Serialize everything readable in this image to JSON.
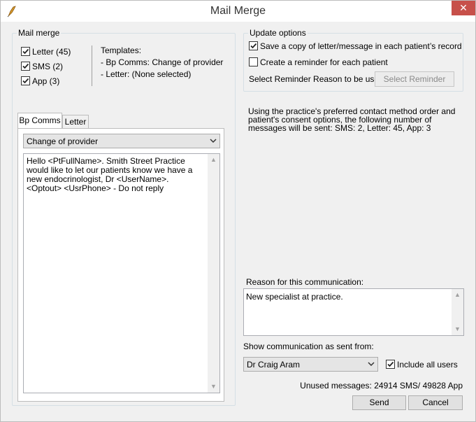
{
  "window": {
    "title": "Mail Merge",
    "close_glyph": "✕"
  },
  "mail_merge": {
    "group_label": "Mail merge",
    "checks": [
      {
        "label": "Letter (45)",
        "checked": true
      },
      {
        "label": "SMS  (2)",
        "checked": true
      },
      {
        "label": "App  (3)",
        "checked": true
      }
    ],
    "templates_heading": "Templates:",
    "templates": [
      "- Bp Comms: Change of provider",
      "- Letter: (None selected)"
    ],
    "tabs": [
      {
        "label": "Bp Comms",
        "active": true
      },
      {
        "label": "Letter",
        "active": false
      }
    ],
    "template_select": "Change of provider",
    "message_text": "Hello <PtFullName>. Smith Street Practice would like to let our patients know we have a new endocrinologist, Dr <UserName>. <Optout> <UsrPhone> - Do not reply"
  },
  "update_options": {
    "group_label": "Update options",
    "save_copy": {
      "label": "Save a copy of letter/message in each patient’s record",
      "checked": true
    },
    "create_reminder": {
      "label": "Create a reminder for each patient",
      "checked": false
    },
    "reminder_reason_label": "Select Reminder Reason to be used:",
    "select_reminder_button": "Select Reminder"
  },
  "info_text": "Using the practice's preferred contact method order and patient's consent options, the following number of messages will be sent: SMS: 2, Letter: 45, App: 3",
  "reason": {
    "label": "Reason for this communication:",
    "value": "New specialist at practice."
  },
  "sent_from": {
    "label": "Show communication as sent from:",
    "selected": "Dr Craig Aram",
    "include_all_users": {
      "label": "Include all users",
      "checked": true
    }
  },
  "unused_messages": "Unused messages: 24914 SMS/ 49828 App",
  "buttons": {
    "send": "Send",
    "cancel": "Cancel"
  },
  "icons": {
    "app": "bird-feather-icon",
    "dropdown": "chevron-down-icon",
    "scroll_up": "scroll-up-icon",
    "scroll_down": "scroll-down-icon"
  }
}
